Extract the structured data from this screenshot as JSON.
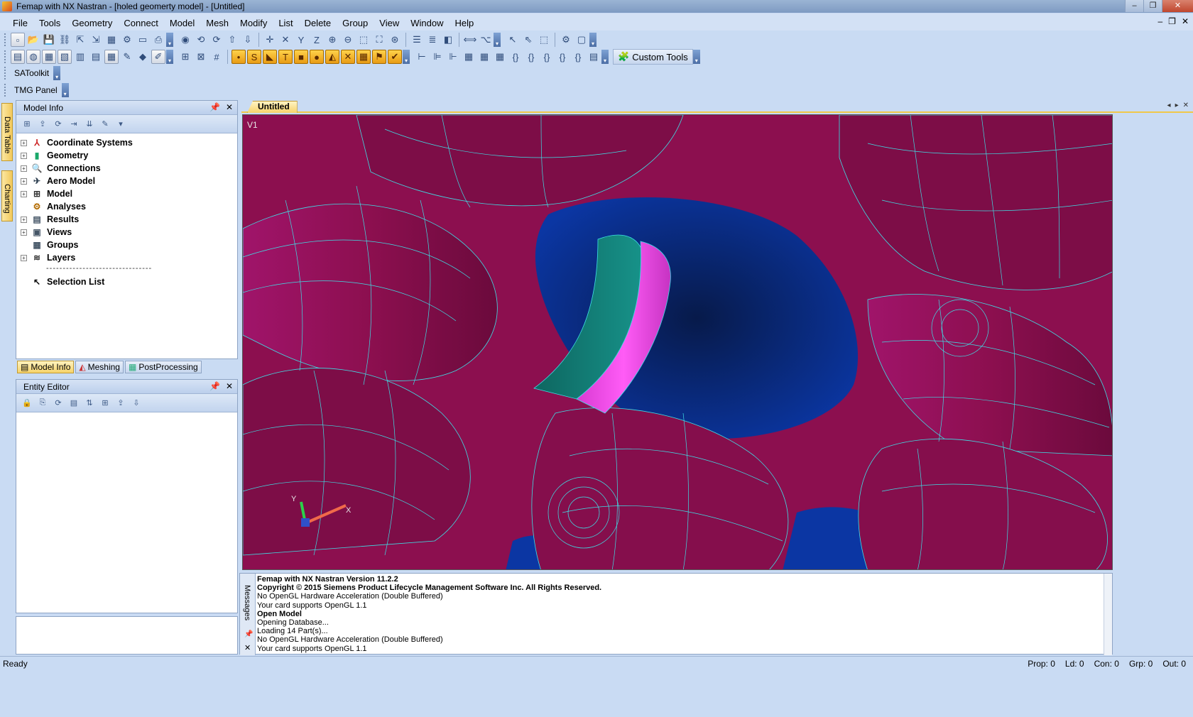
{
  "window": {
    "title": "Femap with NX Nastran - [holed geomerty model] - [Untitled]",
    "controls": [
      "minimize",
      "maximize",
      "close"
    ]
  },
  "menu": [
    "File",
    "Tools",
    "Geometry",
    "Connect",
    "Model",
    "Mesh",
    "Modify",
    "List",
    "Delete",
    "Group",
    "View",
    "Window",
    "Help"
  ],
  "toolbars": {
    "custom_tools_label": "Custom Tools",
    "satoolkit_label": "SAToolkit",
    "tmg_panel_label": "TMG Panel"
  },
  "side_tabs": [
    "Data Table",
    "Charting"
  ],
  "model_info": {
    "title": "Model Info",
    "tree": [
      {
        "label": "Coordinate Systems",
        "icon": "coordinate-systems-icon",
        "expandable": true
      },
      {
        "label": "Geometry",
        "icon": "geometry-icon",
        "expandable": true
      },
      {
        "label": "Connections",
        "icon": "connections-icon",
        "expandable": true
      },
      {
        "label": "Aero Model",
        "icon": "aero-model-icon",
        "expandable": true
      },
      {
        "label": "Model",
        "icon": "model-icon",
        "expandable": true
      },
      {
        "label": "Analyses",
        "icon": "analyses-icon",
        "expandable": false
      },
      {
        "label": "Results",
        "icon": "results-icon",
        "expandable": true
      },
      {
        "label": "Views",
        "icon": "views-icon",
        "expandable": true
      },
      {
        "label": "Groups",
        "icon": "groups-icon",
        "expandable": false
      },
      {
        "label": "Layers",
        "icon": "layers-icon",
        "expandable": true
      }
    ],
    "separator": "--------------------------------",
    "selection_list": "Selection List"
  },
  "panel_tabs": [
    "Model Info",
    "Meshing",
    "PostProcessing"
  ],
  "entity_editor": {
    "title": "Entity Editor"
  },
  "document": {
    "tab": "Untitled",
    "view_label": "V1",
    "axis_labels": {
      "x": "X",
      "y": "Y"
    }
  },
  "messages": {
    "side_label": "Messages",
    "lines": [
      {
        "text": "Femap with NX Nastran Version 11.2.2",
        "bold": true
      },
      {
        "text": "Copyright © 2015 Siemens Product Lifecycle Management Software Inc. All Rights Reserved.",
        "bold": true
      },
      {
        "text": "No OpenGL Hardware Acceleration (Double Buffered)",
        "bold": false
      },
      {
        "text": "Your card supports OpenGL 1.1",
        "bold": false
      },
      {
        "text": "Open Model",
        "bold": true
      },
      {
        "text": "Opening Database...",
        "bold": false
      },
      {
        "text": "Loading 14 Part(s)...",
        "bold": false
      },
      {
        "text": "No OpenGL Hardware Acceleration (Double Buffered)",
        "bold": false
      },
      {
        "text": "Your card supports OpenGL 1.1",
        "bold": false
      }
    ]
  },
  "status": {
    "ready": "Ready",
    "prop": "Prop: 0",
    "ld": "Ld: 0",
    "con": "Con: 0",
    "grp": "Grp: 0",
    "out": "Out: 0"
  },
  "colors": {
    "surface": "#8c0f4f",
    "mesh_lines": "#3ee0e6",
    "background": "#0a2a7a",
    "highlight_teal": "#13827a",
    "highlight_magenta": "#f04ae8"
  }
}
